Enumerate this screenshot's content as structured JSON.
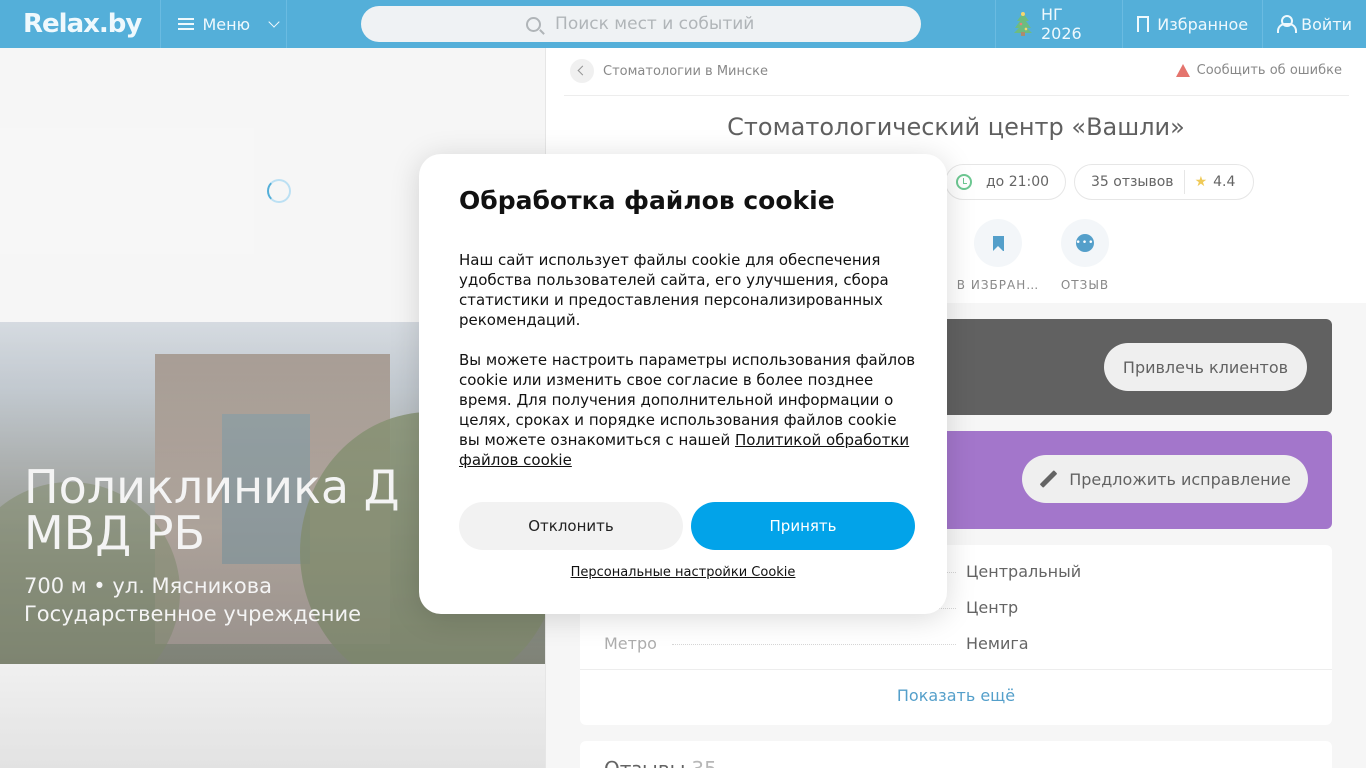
{
  "header": {
    "logo": "Relax.by",
    "menu_label": "Меню",
    "search_placeholder": "Поиск мест и событий",
    "ny_label": "НГ 2026",
    "favorites_label": "Избранное",
    "login_label": "Войти"
  },
  "hero": {
    "title_line1": "Поликлиника Д",
    "title_line2": "МВД РБ",
    "distance_line": "700 м • ул. Мясникова",
    "type_line": "Государственное учреждение"
  },
  "place": {
    "breadcrumb": "Стоматологии в Минске",
    "report_label": "Сообщить об ошибке",
    "title": "Стоматологический центр «Вашли»",
    "hours": "до 21:00",
    "reviews_count": "35 отзывов",
    "rating": "4.4",
    "actions": [
      {
        "label": "В ИЗБРАН…"
      },
      {
        "label": "ОТЗЫВ"
      }
    ],
    "promote_label": "Привлечь клиентов",
    "suggest_label": "Предложить исправление",
    "info": [
      {
        "key": "",
        "value": "Центральный"
      },
      {
        "key": "",
        "value": "Центр"
      },
      {
        "key": "Метро",
        "value": "Немига"
      }
    ],
    "show_more": "Показать ещё",
    "reviews_heading": "Отзывы",
    "reviews_heading_count": "35"
  },
  "cookie_modal": {
    "title": "Обработка файлов cookie",
    "para1": "Наш сайт использует файлы cookie для обеспечения удобства пользователей сайта, его улучшения, сбора статистики и предоставления персонализированных рекомендаций.",
    "para2": "Вы можете настроить параметры использования файлов cookie или изменить свое согласие в более позднее время. Для получения дополнительной информации о целях, сроках и порядке использования файлов cookie вы можете ознакомиться с нашей",
    "policy_link": "Политикой обработки файлов cookie",
    "decline_label": "Отклонить",
    "accept_label": "Принять",
    "settings_link": "Персональные настройки Cookie"
  },
  "colors": {
    "header_bg": "#0b8dc9",
    "accept_bg": "#02a3e9",
    "purple_card": "#7b3bb5",
    "dark_card": "#1d1d1d"
  },
  "icons": [
    "search-icon",
    "christmas-tree-icon",
    "bookmark-icon",
    "user-icon",
    "chevron-left-icon",
    "warning-icon",
    "clock-icon",
    "star-icon",
    "bookmark-solid-icon",
    "chat-icon",
    "pencil-icon",
    "loading-spinner-icon"
  ]
}
